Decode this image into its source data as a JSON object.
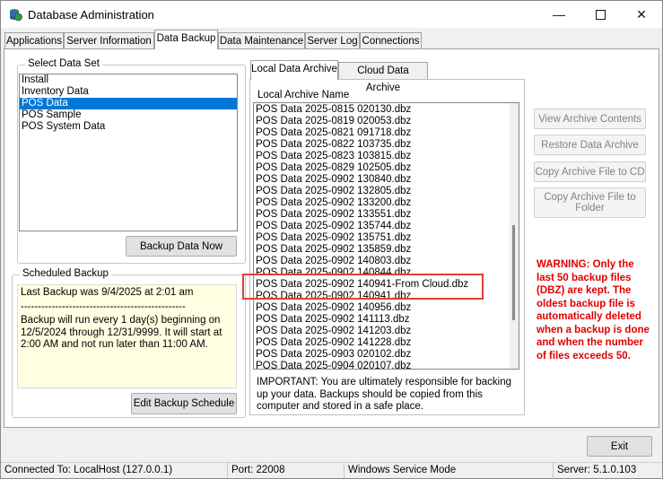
{
  "window": {
    "title": "Database Administration"
  },
  "tabs": [
    "Applications",
    "Server Information",
    "Data Backup",
    "Data Maintenance",
    "Server Log",
    "Connections"
  ],
  "select_data_set": {
    "label": "Select Data Set",
    "items": [
      "Install",
      "Inventory Data",
      "POS Data",
      "POS Sample",
      "POS System Data"
    ],
    "selected": "POS Data",
    "backup_button": "Backup Data Now"
  },
  "scheduled_backup": {
    "label": "Scheduled Backup",
    "last_backup": "Last Backup was 9/4/2025 at 2:01 am",
    "separator": "------------------------------------------------",
    "schedule_lines": [
      "Backup will run every 1 day(s) beginning on",
      "12/5/2024 through 12/31/9999.  It will start at",
      "2:00 AM and not run later than 11:00 AM."
    ],
    "edit_button": "Edit Backup Schedule"
  },
  "archive_tabs": [
    "Local Data Archive",
    "Cloud Data Archive"
  ],
  "local_archive": {
    "column_header": "Local Archive Name",
    "files": [
      "POS Data 2025-0815 020130.dbz",
      "POS Data 2025-0819 020053.dbz",
      "POS Data 2025-0821 091718.dbz",
      "POS Data 2025-0822 103735.dbz",
      "POS Data 2025-0823 103815.dbz",
      "POS Data 2025-0829 102505.dbz",
      "POS Data 2025-0902 130840.dbz",
      "POS Data 2025-0902 132805.dbz",
      "POS Data 2025-0902 133200.dbz",
      "POS Data 2025-0902 133551.dbz",
      "POS Data 2025-0902 135744.dbz",
      "POS Data 2025-0902 135751.dbz",
      "POS Data 2025-0902 135859.dbz",
      "POS Data 2025-0902 140803.dbz",
      "POS Data 2025-0902 140844.dbz",
      "POS Data 2025-0902 140941-From Cloud.dbz",
      "POS Data 2025-0902 140941.dbz",
      "POS Data 2025-0902 140956.dbz",
      "POS Data 2025-0902 141113.dbz",
      "POS Data 2025-0902 141203.dbz",
      "POS Data 2025-0902 141228.dbz",
      "POS Data 2025-0903 020102.dbz",
      "POS Data 2025-0904 020107.dbz"
    ],
    "highlighted": "POS Data 2025-0902 140941-From Cloud.dbz",
    "important_note": "IMPORTANT: You are ultimately responsible for backing up your data. Backups should be copied from this computer and stored in a safe place."
  },
  "actions": [
    "View Archive Contents",
    "Restore Data Archive",
    "Copy Archive File to CD",
    "Copy Archive File to Folder"
  ],
  "warning": "WARNING: Only the last 50 backup files (DBZ) are kept. The oldest backup file is automatically deleted when a backup is done and when the number of files exceeds 50.",
  "exit_button": "Exit",
  "status_bar": {
    "connected": "Connected To: LocalHost (127.0.0.1)",
    "port": "Port: 22008",
    "mode": "Windows Service Mode",
    "server": "Server: 5.1.0.103"
  },
  "colors": {
    "highlight_box": "#e0403a",
    "warning_text": "#e00000",
    "selection": "#0078d7"
  },
  "icons": {
    "app": "database-globe-icon",
    "minimize": "minimize-icon",
    "maximize": "maximize-icon",
    "close": "close-icon"
  }
}
